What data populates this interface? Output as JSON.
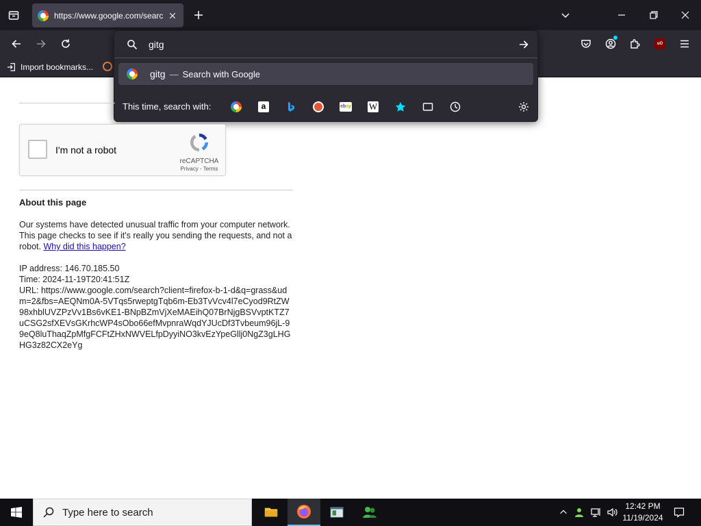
{
  "browser": {
    "tab": {
      "title": "https://www.google.com/searc",
      "favicon": "google-logo-icon"
    },
    "url_input": {
      "value": "gitg"
    },
    "suggestion": {
      "query": "gitg",
      "separator": "—",
      "hint": "Search with Google"
    },
    "oneoff_label": "This time, search with:",
    "engines": [
      "google",
      "amazon",
      "bing",
      "duckduckgo",
      "ebay",
      "wikipedia",
      "bookmarks",
      "tabs",
      "history"
    ],
    "bookmarks": {
      "import_label": "Import bookmarks..."
    }
  },
  "page": {
    "captcha": {
      "label": "I'm not a robot",
      "brand": "reCAPTCHA",
      "links": "Privacy - Terms"
    },
    "about_title": "About this page",
    "para1": "Our systems have detected unusual traffic from your computer network. This page checks to see if it's really you sending the requests, and not a robot. ",
    "why_link": "Why did this happen?",
    "ip": "IP address: 146.70.185.50",
    "time": "Time: 2024-11-19T20:41:51Z",
    "url": "URL: https://www.google.com/search?client=firefox-b-1-d&q=grass&udm=2&fbs=AEQNm0A-5VTqs5rweptgTqb6m-Eb3TvVcv4l7eCyod9RtZW98xhblUVZPzVv1Bs6vKE1-BNpBZmVjXeMAEihQ07BrNjgBSVvptKTZ7uCSG2sfXEVsGKrhcWP4sObo66efMvpnraWqdYJUcDf3Tvbeum96jL-99eQ8luThaqZpMfgFCFtZHxNWVELfpDyyiNO3kvEzYpeGllj0NgZ3gLHGHG3z82CX2eYg"
  },
  "taskbar": {
    "search_placeholder": "Type here to search",
    "time": "12:42 PM",
    "date": "11/19/2024"
  },
  "colors": {
    "accent": "#76b9ed",
    "link": "#1a0dab",
    "chrome_dark": "#1c1b22",
    "chrome": "#2b2a33"
  }
}
